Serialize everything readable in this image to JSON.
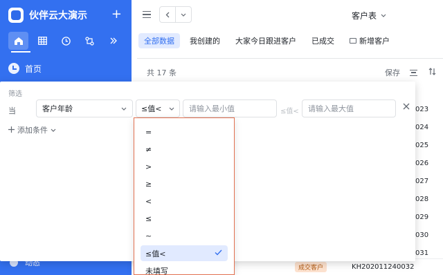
{
  "app": {
    "name": "伙伴云大演示",
    "add_icon": "+"
  },
  "sidebar": {
    "nav_icons": [
      "home-icon",
      "grid-icon",
      "clock-icon",
      "flow-icon",
      "more-icon"
    ],
    "home_label": "首页",
    "bottom_label": "动态"
  },
  "header": {
    "table_title": "客户表"
  },
  "tabs": [
    {
      "label": "全部数据",
      "active": true
    },
    {
      "label": "我创建的"
    },
    {
      "label": "大家今日跟进客户"
    },
    {
      "label": "已成交"
    },
    {
      "label": "新增客户"
    }
  ],
  "table": {
    "count_text": "共 17 条",
    "save_label": "保存",
    "codes": [
      "023",
      "024",
      "025",
      "026",
      "027",
      "028",
      "029",
      "030",
      "031"
    ],
    "last_row": {
      "badge": "成交客户",
      "code": "KH202011240032"
    }
  },
  "filter": {
    "title": "筛选",
    "when": "当",
    "field": "客户年龄",
    "operator": "≤值<",
    "min_placeholder": "请输入最小值",
    "mid_op": "≤值<",
    "max_placeholder": "请输入最大值",
    "add_label": "添加条件"
  },
  "operator_menu": {
    "items": [
      "=",
      "≠",
      ">",
      "≥",
      "<",
      "≤",
      "~",
      "≤值<",
      "未填写"
    ],
    "selected": "≤值<"
  },
  "colors": {
    "brand": "#3370f0",
    "highlight_border": "#e2704f",
    "badge_bg": "#fde2cf"
  }
}
